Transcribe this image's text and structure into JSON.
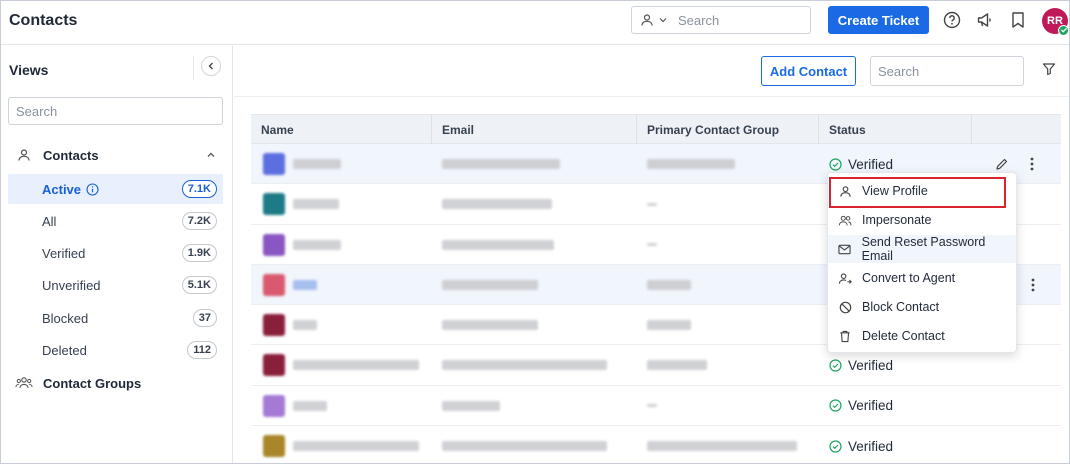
{
  "header": {
    "title": "Contacts",
    "search_placeholder": "Search",
    "create_ticket_label": "Create Ticket",
    "avatar_initials": "RR"
  },
  "sidebar": {
    "title": "Views",
    "search_placeholder": "Search",
    "group_contacts": "Contacts",
    "items": [
      {
        "label": "Active",
        "count": "7.1K",
        "active": true
      },
      {
        "label": "All",
        "count": "7.2K"
      },
      {
        "label": "Verified",
        "count": "1.9K"
      },
      {
        "label": "Unverified",
        "count": "5.1K"
      },
      {
        "label": "Blocked",
        "count": "37"
      },
      {
        "label": "Deleted",
        "count": "112"
      }
    ],
    "group_contact_groups": "Contact Groups"
  },
  "main": {
    "add_contact_label": "Add Contact",
    "search_placeholder": "Search",
    "columns": [
      "Name",
      "Email",
      "Primary Contact Group",
      "Status"
    ],
    "rows": [
      {
        "status": "Verified",
        "avatar_color": "#5b6fe0"
      },
      {
        "status": "",
        "avatar_color": "#1d7a86"
      },
      {
        "status": "",
        "avatar_color": "#8a56c2"
      },
      {
        "status": "",
        "avatar_color": "#d95a6e"
      },
      {
        "status": "",
        "avatar_color": "#8a1f3a"
      },
      {
        "status": "Verified",
        "avatar_color": "#8a1f3a"
      },
      {
        "status": "Verified",
        "avatar_color": "#a47ad6"
      },
      {
        "status": "Verified",
        "avatar_color": "#a9862a"
      }
    ]
  },
  "menu": {
    "items": [
      {
        "label": "View Profile",
        "icon": "user-icon"
      },
      {
        "label": "Impersonate",
        "icon": "users-icon"
      },
      {
        "label": "Send Reset Password Email",
        "icon": "mail-icon"
      },
      {
        "label": "Convert to Agent",
        "icon": "user-convert-icon"
      },
      {
        "label": "Block Contact",
        "icon": "block-icon"
      },
      {
        "label": "Delete Contact",
        "icon": "trash-icon"
      }
    ]
  },
  "colors": {
    "primary": "#1a6ae6",
    "verified": "#1fa463",
    "highlight": "#d9232e"
  }
}
